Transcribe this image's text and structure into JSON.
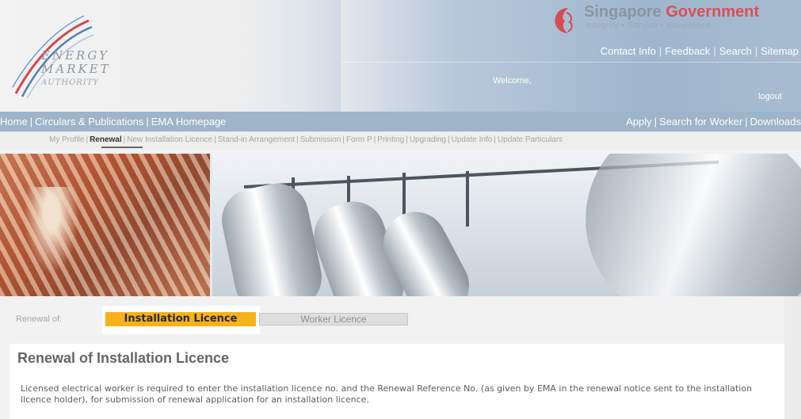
{
  "header": {
    "logo": {
      "line1": "ENERGY",
      "line2": "MARKET",
      "line3": "AUTHORITY"
    },
    "gov": {
      "title_part1": "Singapore ",
      "title_part2": "Government",
      "tagline": "Integrity • Service • Excellence"
    },
    "toplinks": [
      "Contact Info",
      "Feedback",
      "Search",
      "Sitemap"
    ],
    "welcome": "Welcome,",
    "logout": "logout"
  },
  "navbar": {
    "left": [
      "Home",
      "Circulars & Publications",
      "EMA Homepage"
    ],
    "right": [
      "Apply",
      "Search for Worker",
      "Downloads"
    ]
  },
  "subnav": {
    "items": [
      "My Profile",
      "Renewal",
      "New Installation Licence",
      "Stand-in Arrangement",
      "Submission",
      "Form P",
      "Printing",
      "Upgrading",
      "Update Info",
      "Update Particulars"
    ],
    "active_index": 1
  },
  "renewal": {
    "label": "Renewal of:",
    "tabs": [
      {
        "label": "Installation Licence",
        "active": true
      },
      {
        "label": "Worker Licence",
        "active": false
      }
    ]
  },
  "panel": {
    "title": "Renewal of Installation Licence",
    "body": "Licensed electrical worker is required to enter the installation licence no. and the Renewal Reference No. (as given by EMA in the renewal notice sent to the installation licence holder), for submission of renewal application for an installation licence."
  },
  "colors": {
    "accent": "#f7b21a",
    "navbar": "#9db4c9",
    "gov_red": "#d95058"
  }
}
